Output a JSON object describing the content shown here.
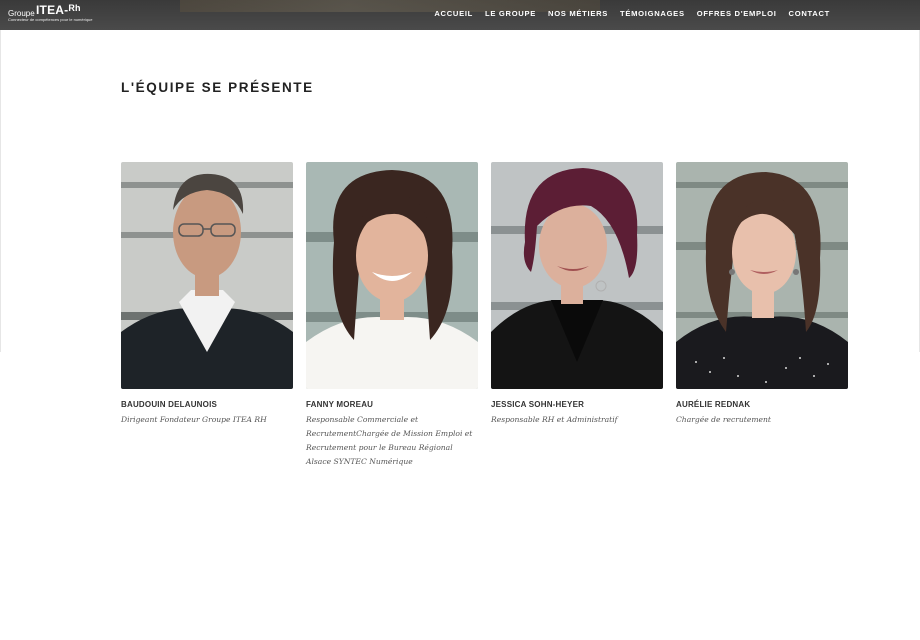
{
  "header": {
    "logo": {
      "prefix": "Groupe",
      "brand": "ITEA-",
      "brand_suffix": "Rh",
      "tagline": "Connecteur de compétences pour le numérique"
    },
    "nav": [
      {
        "label": "ACCUEIL"
      },
      {
        "label": "LE GROUPE"
      },
      {
        "label": "NOS MÉTIERS"
      },
      {
        "label": "TÉMOIGNAGES"
      },
      {
        "label": "OFFRES D'EMPLOI"
      },
      {
        "label": "CONTACT"
      }
    ]
  },
  "main": {
    "title": "L'ÉQUIPE SE PRÉSENTE",
    "team": [
      {
        "name": "BAUDOUIN DELAUNOIS",
        "role": "Dirigeant Fondateur Groupe ITEA RH"
      },
      {
        "name": "FANNY MOREAU",
        "role": "Responsable Commerciale et RecrutementChargée de Mission Emploi et Recrutement pour le Bureau Régional Alsace SYNTEC Numérique"
      },
      {
        "name": "JESSICA SOHN-HEYER",
        "role": "Responsable RH et Administratif"
      },
      {
        "name": "AURÉLIE REDNAK",
        "role": "Chargée de recrutement"
      }
    ]
  },
  "colors": {
    "header_bg": "#3f3f3f",
    "nav_text": "#ffffff",
    "name_text": "#333333",
    "role_text": "#555555"
  }
}
